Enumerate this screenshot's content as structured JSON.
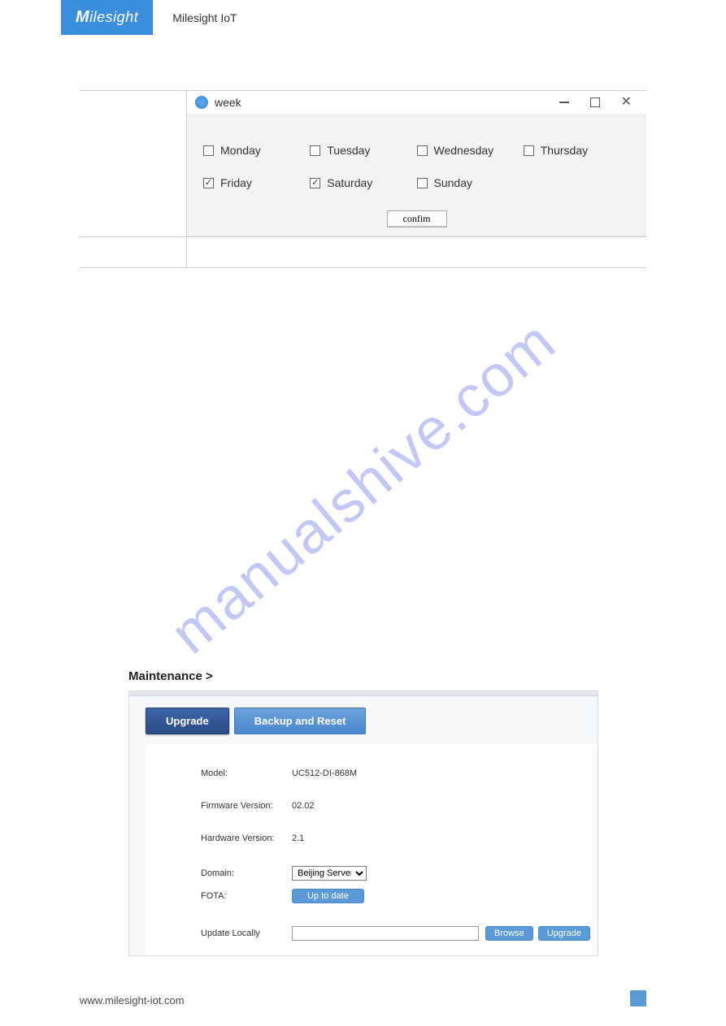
{
  "header": {
    "logo_text": "Milesight",
    "title": "Milesight IoT"
  },
  "week_dialog": {
    "title": "week",
    "days": [
      {
        "label": "Monday",
        "checked": false
      },
      {
        "label": "Tuesday",
        "checked": false
      },
      {
        "label": "Wednesday",
        "checked": false
      },
      {
        "label": "Thursday",
        "checked": false
      },
      {
        "label": "Friday",
        "checked": true
      },
      {
        "label": "Saturday",
        "checked": true
      },
      {
        "label": "Sunday",
        "checked": false
      }
    ],
    "confirm_label": "confim"
  },
  "watermark": "manualshive.com",
  "section": {
    "title": "Maintenance >",
    "tabs": {
      "upgrade": "Upgrade",
      "backup": "Backup and Reset"
    },
    "fields": {
      "model_label": "Model:",
      "model_value": "UC512-DI-868M",
      "fw_label": "Firmware Version:",
      "fw_value": "02.02",
      "hw_label": "Hardware Version:",
      "hw_value": "2.1",
      "domain_label": "Domain:",
      "domain_value": "Beijing Server",
      "fota_label": "FOTA:",
      "fota_status": "Up to date",
      "update_label": "Update Locally",
      "browse": "Browse",
      "upgrade": "Upgrade"
    }
  },
  "footer": {
    "url": "www.milesight-iot.com"
  }
}
